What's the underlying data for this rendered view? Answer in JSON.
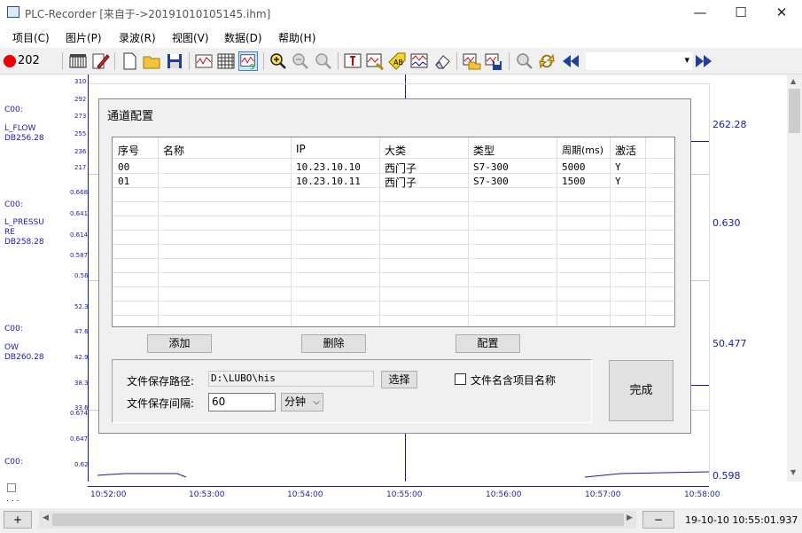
{
  "window": {
    "title": "PLC-Recorder  [来自于->20191010105145.ihm]",
    "minimize": "—",
    "maximize": "☐",
    "close": "✕"
  },
  "menu": [
    "项目(C)",
    "图片(P)",
    "录波(R)",
    "视图(V)",
    "数据(D)",
    "帮助(H)"
  ],
  "toolbar": {
    "record_count": "202",
    "combo_value": "",
    "combo_arrow": "▾"
  },
  "channels": [
    {
      "name": "C00:",
      "sub": "L_FLOW",
      "db": "DB256.28",
      "ticks": [
        "310",
        "292",
        "273",
        "255",
        "236",
        "217"
      ],
      "right_value": "262.28"
    },
    {
      "name": "C00:",
      "sub": "L_PRESSU",
      "sub2": "RE",
      "db": "DB258.28",
      "ticks": [
        "0.668",
        "0.641",
        "0.614",
        "0.587",
        "0.56"
      ],
      "right_value": "0.630"
    },
    {
      "name": "C00:",
      "sub": "OW",
      "db": "DB260.28",
      "ticks": [
        "52.3",
        "47.6",
        "42.9",
        "38.3",
        "33.6"
      ],
      "right_value": "50.477"
    },
    {
      "name": "C00:",
      "sub": "",
      "db": "",
      "ticks": [
        "0.674",
        "0.647",
        "0.62"
      ],
      "right_value": "0.598"
    }
  ],
  "time_axis": [
    "10:52:00",
    "10:53:00",
    "10:54:00",
    "10:55:00",
    "10:56:00",
    "10:57:00",
    "10:58:00"
  ],
  "bottom": {
    "plus": "+",
    "minus": "−",
    "left_arrow": "◀",
    "right_arrow": "▶",
    "timestamp": "19-10-10  10:55:01.937"
  },
  "dialog": {
    "title": "通道配置",
    "columns": [
      "序号",
      "名称",
      "IP",
      "大类",
      "类型",
      "周期(ms)",
      "激活"
    ],
    "rows": [
      [
        "00",
        "",
        "10.23.10.10",
        "西门子",
        "S7-300",
        "5000",
        "Y"
      ],
      [
        "01",
        "",
        "10.23.10.11",
        "西门子",
        "S7-300",
        "1500",
        "Y"
      ]
    ],
    "add_button": "添加",
    "delete_button": "删除",
    "config_button": "配置",
    "path_label": "文件保存路径:",
    "path_value": "D:\\LUBO\\his",
    "choose_button": "选择",
    "checkbox_label": "文件名含项目名称",
    "checkbox_checked": false,
    "interval_label": "文件保存间隔:",
    "interval_value": "60",
    "interval_unit": "分钟",
    "done_button": "完成"
  }
}
